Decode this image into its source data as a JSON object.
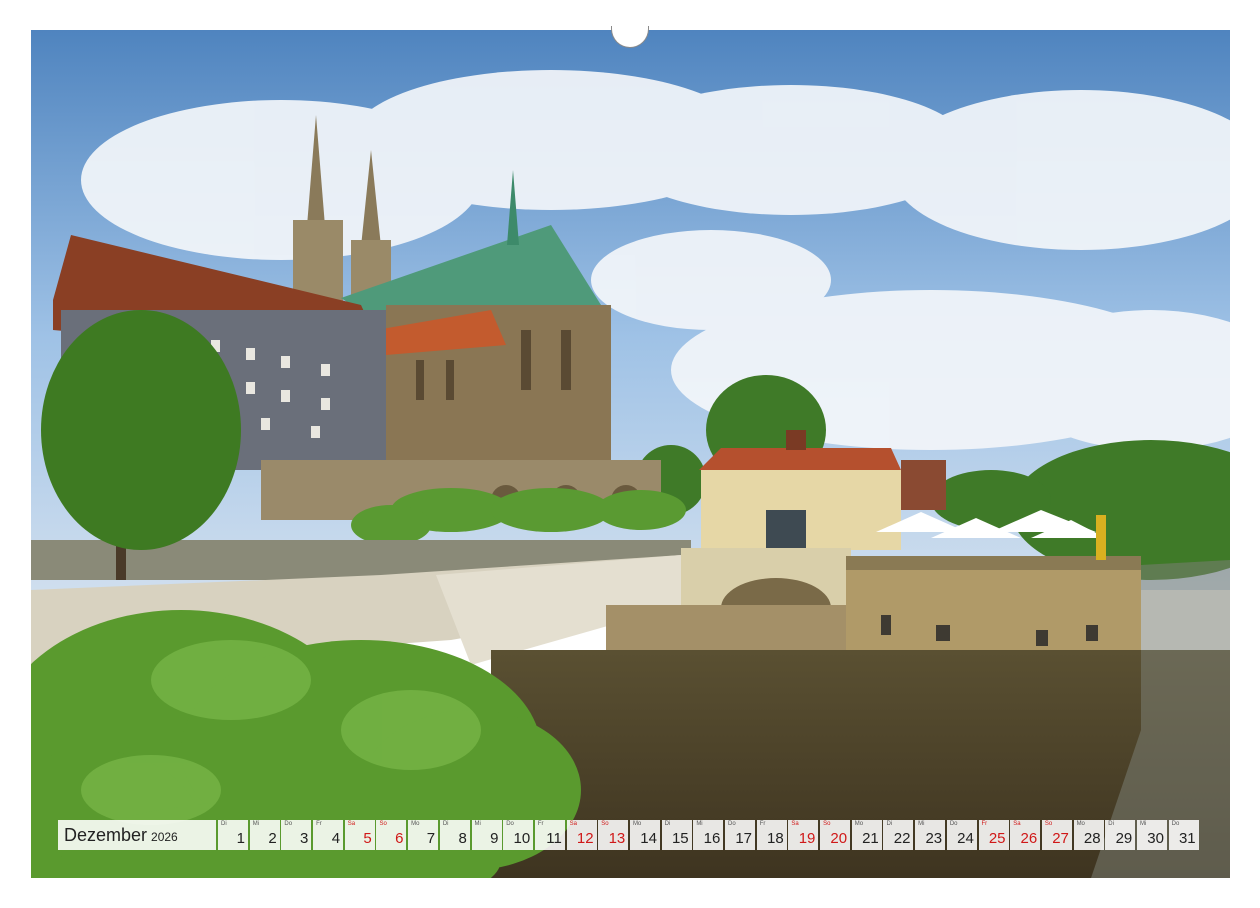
{
  "calendar": {
    "month": "Dezember",
    "year": "2026",
    "weekend_color": "#d01818",
    "days": [
      {
        "wd": "Di",
        "n": "1",
        "we": false
      },
      {
        "wd": "Mi",
        "n": "2",
        "we": false
      },
      {
        "wd": "Do",
        "n": "3",
        "we": false
      },
      {
        "wd": "Fr",
        "n": "4",
        "we": false
      },
      {
        "wd": "Sa",
        "n": "5",
        "we": true
      },
      {
        "wd": "So",
        "n": "6",
        "we": true
      },
      {
        "wd": "Mo",
        "n": "7",
        "we": false
      },
      {
        "wd": "Di",
        "n": "8",
        "we": false
      },
      {
        "wd": "Mi",
        "n": "9",
        "we": false
      },
      {
        "wd": "Do",
        "n": "10",
        "we": false
      },
      {
        "wd": "Fr",
        "n": "11",
        "we": false
      },
      {
        "wd": "Sa",
        "n": "12",
        "we": true
      },
      {
        "wd": "So",
        "n": "13",
        "we": true
      },
      {
        "wd": "Mo",
        "n": "14",
        "we": false
      },
      {
        "wd": "Di",
        "n": "15",
        "we": false
      },
      {
        "wd": "Mi",
        "n": "16",
        "we": false
      },
      {
        "wd": "Do",
        "n": "17",
        "we": false
      },
      {
        "wd": "Fr",
        "n": "18",
        "we": false
      },
      {
        "wd": "Sa",
        "n": "19",
        "we": true
      },
      {
        "wd": "So",
        "n": "20",
        "we": true
      },
      {
        "wd": "Mo",
        "n": "21",
        "we": false
      },
      {
        "wd": "Di",
        "n": "22",
        "we": false
      },
      {
        "wd": "Mi",
        "n": "23",
        "we": false
      },
      {
        "wd": "Do",
        "n": "24",
        "we": false
      },
      {
        "wd": "Fr",
        "n": "25",
        "we": true
      },
      {
        "wd": "Sa",
        "n": "26",
        "we": true
      },
      {
        "wd": "So",
        "n": "27",
        "we": true
      },
      {
        "wd": "Mo",
        "n": "28",
        "we": false
      },
      {
        "wd": "Di",
        "n": "29",
        "we": false
      },
      {
        "wd": "Mi",
        "n": "30",
        "we": false
      },
      {
        "wd": "Do",
        "n": "31",
        "we": false
      }
    ]
  },
  "photo": {
    "subject": "church-riverside-town-photo",
    "colors": {
      "sky": "#6f9fd0",
      "river": "#4e4228",
      "foliage": "#4f8a2a",
      "roof": "#b5502e",
      "copper": "#4f9a7a"
    }
  }
}
